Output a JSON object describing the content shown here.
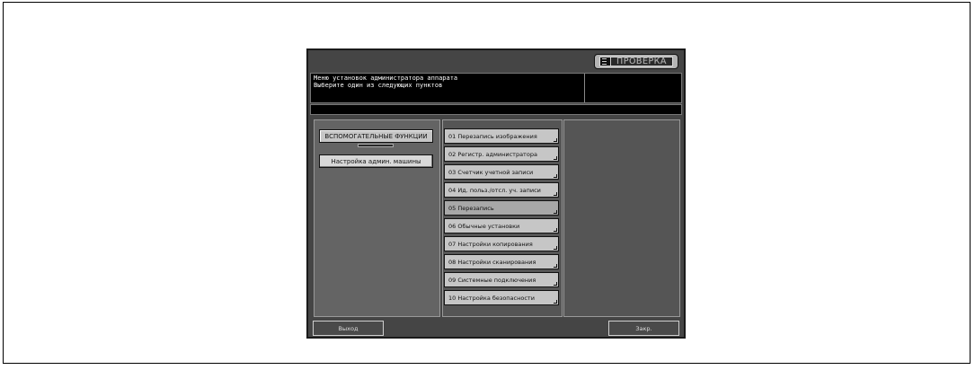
{
  "header": {
    "check_button_label": "ПРОВЕРКА"
  },
  "message": {
    "line1": "Меню установок администратора аппарата",
    "line2": "Выберите один из следующих пунктов"
  },
  "left_panel": {
    "aux_functions_label": "ВСПОМОГАТЕЛЬНЫЕ ФУНКЦИИ",
    "admin_settings_label": "Настройка админ. машины"
  },
  "menu_items": [
    {
      "label": "01 Перезапись изображения"
    },
    {
      "label": "02 Регистр. администратора"
    },
    {
      "label": "03 Счетчик учетной записи"
    },
    {
      "label": "04 Ид. польз./отсл. уч. записи"
    },
    {
      "label": "05 Перезапись"
    },
    {
      "label": "06 Обычные установки"
    },
    {
      "label": "07 Настройки копирования"
    },
    {
      "label": "08 Настройки сканирования"
    },
    {
      "label": "09 Системные подключения"
    },
    {
      "label": "10 Настройка безопасности"
    }
  ],
  "footer": {
    "exit_label": "Выход",
    "close_label": "Закр."
  },
  "colors": {
    "screen_bg": "#454545",
    "button_bg": "#c6c6c6",
    "message_bg": "#000000"
  }
}
